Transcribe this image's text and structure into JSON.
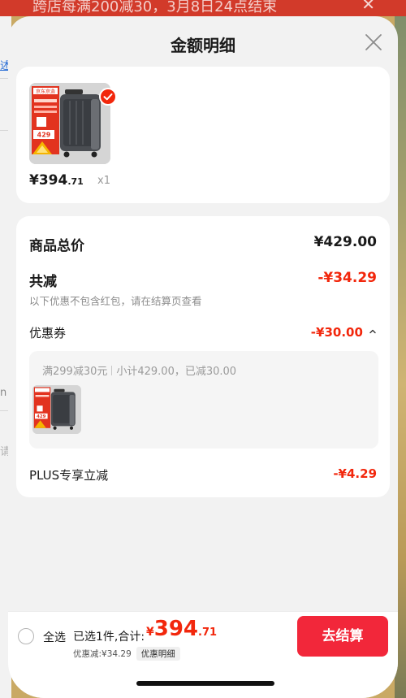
{
  "background": {
    "banner_text": "跨店每满200减30，3月8日24点结束",
    "left_fragments": [
      "述",
      "n",
      "请"
    ]
  },
  "sheet": {
    "title": "金额明细"
  },
  "product": {
    "price_integer": "¥394",
    "price_decimal": ".71",
    "quantity": "x1",
    "image_labels": {
      "brand": "京东京造",
      "price_tag": "429"
    }
  },
  "detail": {
    "goods_total_label": "商品总价",
    "goods_total_value": "¥429.00",
    "total_reduce_label": "共减",
    "total_reduce_value": "-¥34.29",
    "reduce_note": "以下优惠不包含红包，请在结算页查看",
    "coupon_label": "优惠券",
    "coupon_value": "-¥30.00",
    "coupon_rule": "满299减30元",
    "coupon_subtotal": "小计429.00，已减30.00",
    "plus_label": "PLUS专享立减",
    "plus_value": "-¥4.29"
  },
  "bottom_bar": {
    "select_all_label": "全选",
    "selected_info": "已选1件,合计:",
    "total_symbol": "¥",
    "total_integer": "394",
    "total_decimal": ".71",
    "discount_text": "优惠减:¥34.29",
    "detail_tag": "优惠明细",
    "checkout_label": "去结算"
  },
  "colors": {
    "accent_red": "#f2270c",
    "button_red": "#f2273a"
  }
}
